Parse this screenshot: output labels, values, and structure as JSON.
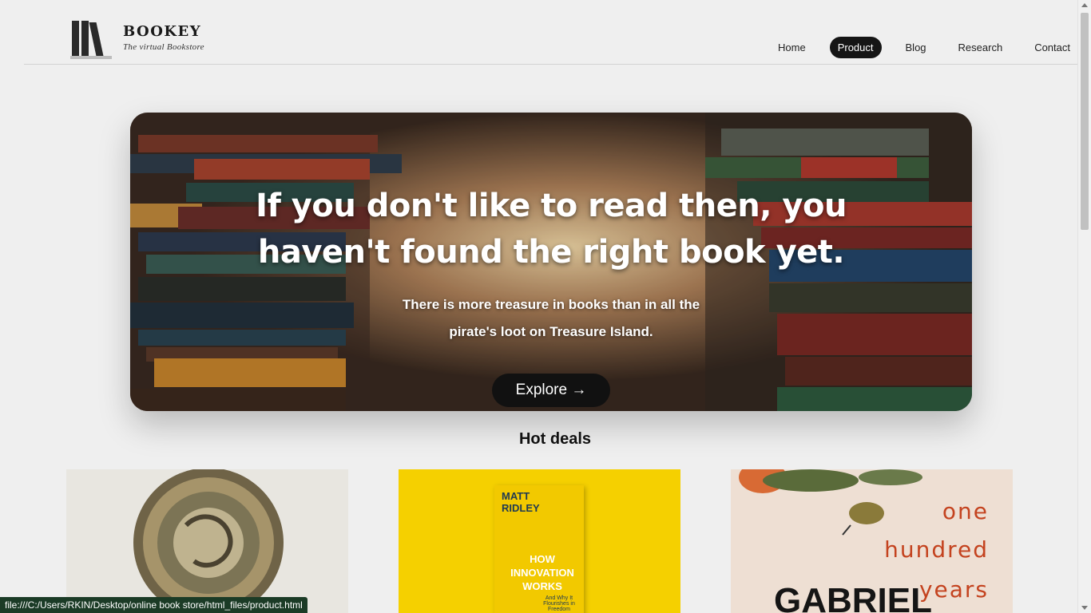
{
  "brand": {
    "name": "BOOKEY",
    "tagline": "The virtual Bookstore"
  },
  "nav": {
    "items": [
      {
        "label": "Home"
      },
      {
        "label": "Product",
        "active": true
      },
      {
        "label": "Blog"
      },
      {
        "label": "Research"
      },
      {
        "label": "Contact"
      }
    ]
  },
  "hero": {
    "title": "If you don't like to read then, you haven't found the right book yet.",
    "subtitle": "There is more treasure in books than in all the pirate's loot on Treasure Island.",
    "button_label": "Explore →"
  },
  "deals": {
    "title": "Hot deals",
    "cards": [
      {
        "cover_text": ""
      },
      {
        "author": "MATT RIDLEY",
        "book_title": "HOW INNOVATION WORKS",
        "subtitle": "And Why It Flourishes in Freedom"
      },
      {
        "cover_words": [
          "one",
          "hundred",
          "years"
        ],
        "author": "GABRIEL"
      }
    ]
  },
  "status_url": "file:///C:/Users/RKIN/Desktop/online book store/html_files/product.html",
  "colors": {
    "accent": "#151515",
    "page_bg": "#efefef",
    "deal2_bg": "#f5d000"
  }
}
